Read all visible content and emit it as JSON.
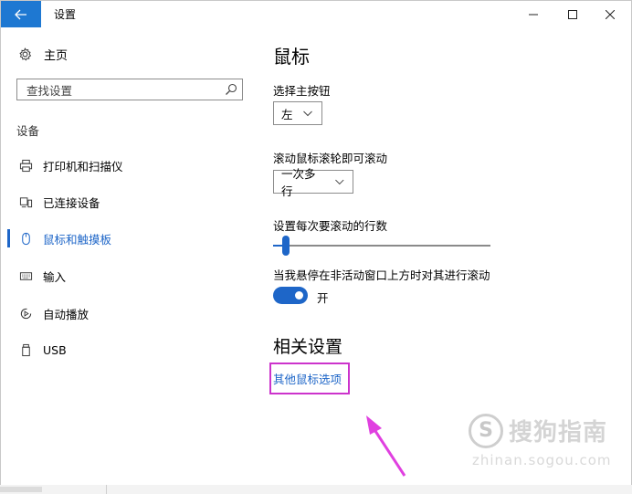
{
  "window": {
    "title": "设置",
    "back_icon": "arrow-left-icon",
    "controls": {
      "minimize": "—",
      "maximize": "☐",
      "close": "✕"
    }
  },
  "sidebar": {
    "home_label": "主页",
    "home_icon": "gear-icon",
    "search_placeholder": "查找设置",
    "search_icon": "search-icon",
    "section_label": "设备",
    "items": [
      {
        "label": "打印机和扫描仪",
        "icon": "printer-icon",
        "active": false
      },
      {
        "label": "已连接设备",
        "icon": "connected-devices-icon",
        "active": false
      },
      {
        "label": "鼠标和触摸板",
        "icon": "mouse-icon",
        "active": true
      },
      {
        "label": "输入",
        "icon": "keyboard-icon",
        "active": false
      },
      {
        "label": "自动播放",
        "icon": "autoplay-icon",
        "active": false
      },
      {
        "label": "USB",
        "icon": "usb-icon",
        "active": false
      }
    ]
  },
  "main": {
    "title": "鼠标",
    "primary_button": {
      "label": "选择主按钮",
      "value": "左"
    },
    "scroll_wheel": {
      "label": "滚动鼠标滚轮即可滚动",
      "value": "一次多行"
    },
    "scroll_lines": {
      "label": "设置每次要滚动的行数",
      "value_fraction": 0.06
    },
    "inactive_scroll": {
      "label": "当我悬停在非活动窗口上方时对其进行滚动",
      "state_label": "开",
      "on": true
    },
    "related_title": "相关设置",
    "related_link": "其他鼠标选项"
  },
  "colors": {
    "accent": "#1e66c8",
    "back_button": "#1e78d2",
    "annotation": "#cc33cc"
  },
  "watermark": {
    "logo_glyph": "S",
    "text": "搜狗指南",
    "url": "zhinan.sogou.com"
  }
}
